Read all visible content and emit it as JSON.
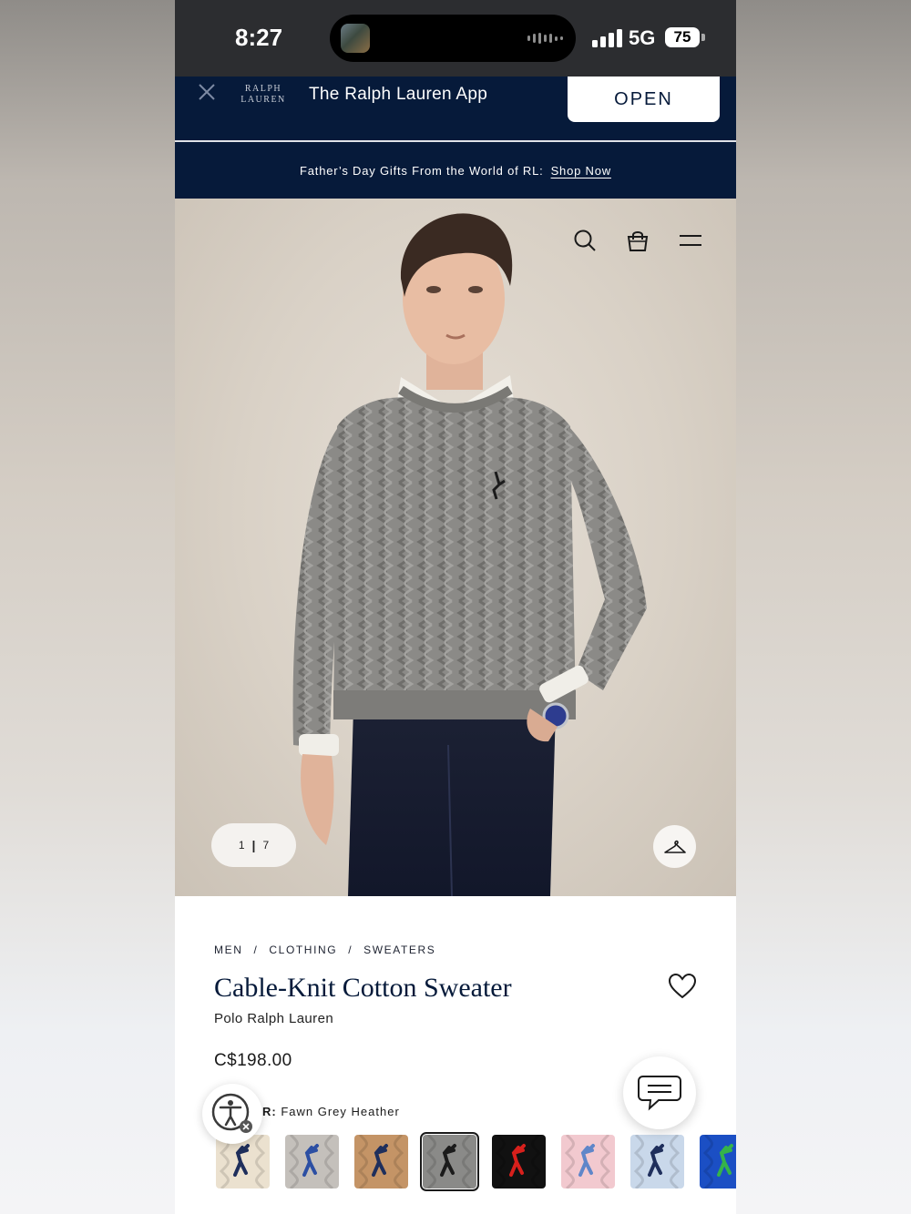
{
  "status_bar": {
    "time": "8:27",
    "network": "5G",
    "battery": "75"
  },
  "app_banner": {
    "logo_line1": "RALPH",
    "logo_line2": "LAUREN",
    "title": "The Ralph Lauren App",
    "open_label": "OPEN"
  },
  "promo": {
    "text": "Father’s Day Gifts From the World of RL:",
    "link": "Shop Now"
  },
  "gallery": {
    "current": "1",
    "separator": "|",
    "total": "7"
  },
  "breadcrumb": [
    "MEN",
    "/",
    "CLOTHING",
    "/",
    "SWEATERS"
  ],
  "product": {
    "title": "Cable-Knit Cotton Sweater",
    "brand": "Polo Ralph Lauren",
    "price": "C$198.00",
    "color_label": "R:",
    "color_value": "Fawn Grey Heather"
  },
  "swatches": [
    {
      "bg": "#ebe1cf",
      "logo": "#1f2f5c"
    },
    {
      "bg": "#c4c0bb",
      "logo": "#2c4fa3"
    },
    {
      "bg": "#c49466",
      "logo": "#1f2f5c"
    },
    {
      "bg": "#8a8a88",
      "logo": "#1b1b1b",
      "selected": true
    },
    {
      "bg": "#111111",
      "logo": "#d8201c"
    },
    {
      "bg": "#f2c9cf",
      "logo": "#5f86c9"
    },
    {
      "bg": "#c9d8ea",
      "logo": "#1f2f5c"
    },
    {
      "bg": "#1b4fc4",
      "logo": "#35b34a"
    }
  ],
  "icons": {
    "close": "close-icon",
    "search": "search-icon",
    "bag": "shopping-bag-icon",
    "menu": "menu-icon",
    "hanger": "hanger-icon",
    "heart": "heart-icon",
    "chat": "chat-icon",
    "accessibility": "accessibility-icon"
  },
  "colors": {
    "navy": "#061a3a",
    "status_bg": "#2c2d30",
    "hero_bg": "#d9d1c6"
  }
}
